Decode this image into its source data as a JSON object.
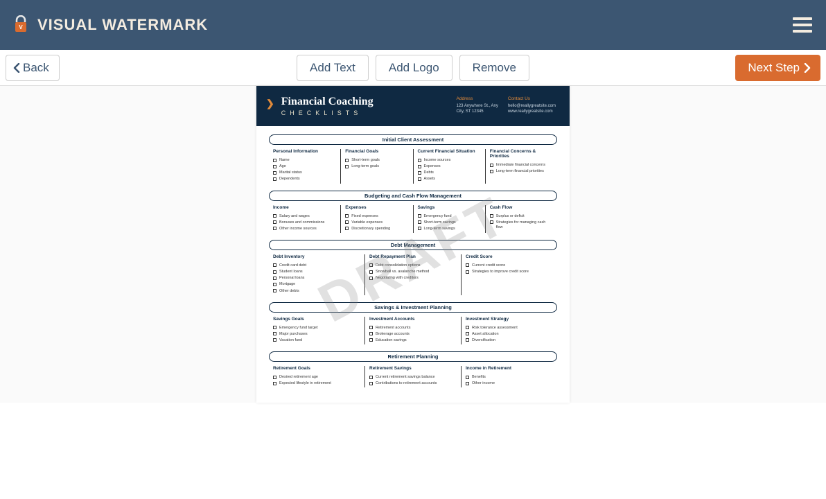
{
  "app": {
    "name": "VISUAL WATERMARK"
  },
  "toolbar": {
    "back": "Back",
    "addText": "Add Text",
    "addLogo": "Add Logo",
    "remove": "Remove",
    "next": "Next Step"
  },
  "watermark": "DRAFT",
  "doc": {
    "title": "Financial Coaching",
    "subtitle": "CHECKLISTS",
    "address": {
      "label": "Address",
      "line1": "123 Anywhere St., Any",
      "line2": "City, ST 12345"
    },
    "contact": {
      "label": "Contact Us",
      "line1": "hello@reallygreatsite.com",
      "line2": "www.reallygreatsite.com"
    },
    "sections": [
      {
        "title": "Initial Client Assessment",
        "columns": [
          {
            "head": "Personal Information",
            "items": [
              "Name",
              "Age",
              "Marital status",
              "Dependents"
            ]
          },
          {
            "head": "Financial Goals",
            "items": [
              "Short-term goals",
              "Long-term goals"
            ]
          },
          {
            "head": "Current Financial Situation",
            "items": [
              "Income sources",
              "Expenses",
              "Debts",
              "Assets"
            ]
          },
          {
            "head": "Financial Concerns & Priorities",
            "items": [
              "Immediate financial concerns",
              "Long-term financial priorities"
            ]
          }
        ]
      },
      {
        "title": "Budgeting and Cash Flow Management",
        "columns": [
          {
            "head": "Income",
            "items": [
              "Salary and wages",
              "Bonuses and commissions",
              "Other income sources"
            ]
          },
          {
            "head": "Expenses",
            "items": [
              "Fixed expenses",
              "Variable expenses",
              "Discretionary spending"
            ]
          },
          {
            "head": "Savings",
            "items": [
              "Emergency fund",
              "Short-term savings",
              "Long-term savings"
            ]
          },
          {
            "head": "Cash Flow",
            "items": [
              "Surplus or deficit",
              "Strategies for managing cash flow"
            ]
          }
        ]
      },
      {
        "title": "Debt Management",
        "columns": [
          {
            "head": "Debt Inventory",
            "items": [
              "Credit card debt",
              "Student loans",
              "Personal loans",
              "Mortgage",
              "Other debts"
            ]
          },
          {
            "head": "Debt Repayment Plan",
            "items": [
              "Debt consolidation options",
              "Snowball vs. avalanche method",
              "Negotiating with creditors"
            ]
          },
          {
            "head": "Credit Score",
            "items": [
              "Current credit score",
              "Strategies to improve credit score"
            ]
          }
        ]
      },
      {
        "title": "Savings & Investment Planning",
        "columns": [
          {
            "head": "Savings Goals",
            "items": [
              "Emergency fund target",
              "Major purchases",
              "Vacation fund"
            ]
          },
          {
            "head": "Investment Accounts",
            "items": [
              "Retirement accounts",
              "Brokerage accounts",
              "Education savings"
            ]
          },
          {
            "head": "Investment Strategy",
            "items": [
              "Risk tolerance assessment",
              "Asset allocation",
              "Diversification"
            ]
          }
        ]
      },
      {
        "title": "Retirement Planning",
        "columns": [
          {
            "head": "Retirement Goals",
            "items": [
              "Desired retirement age",
              "Expected lifestyle in retirement"
            ]
          },
          {
            "head": "Retirement Savings",
            "items": [
              "Current retirement savings balance",
              "Contributions to retirement accounts"
            ]
          },
          {
            "head": "Income in Retirement",
            "items": [
              "Benefits",
              "Other income"
            ]
          }
        ]
      }
    ]
  }
}
